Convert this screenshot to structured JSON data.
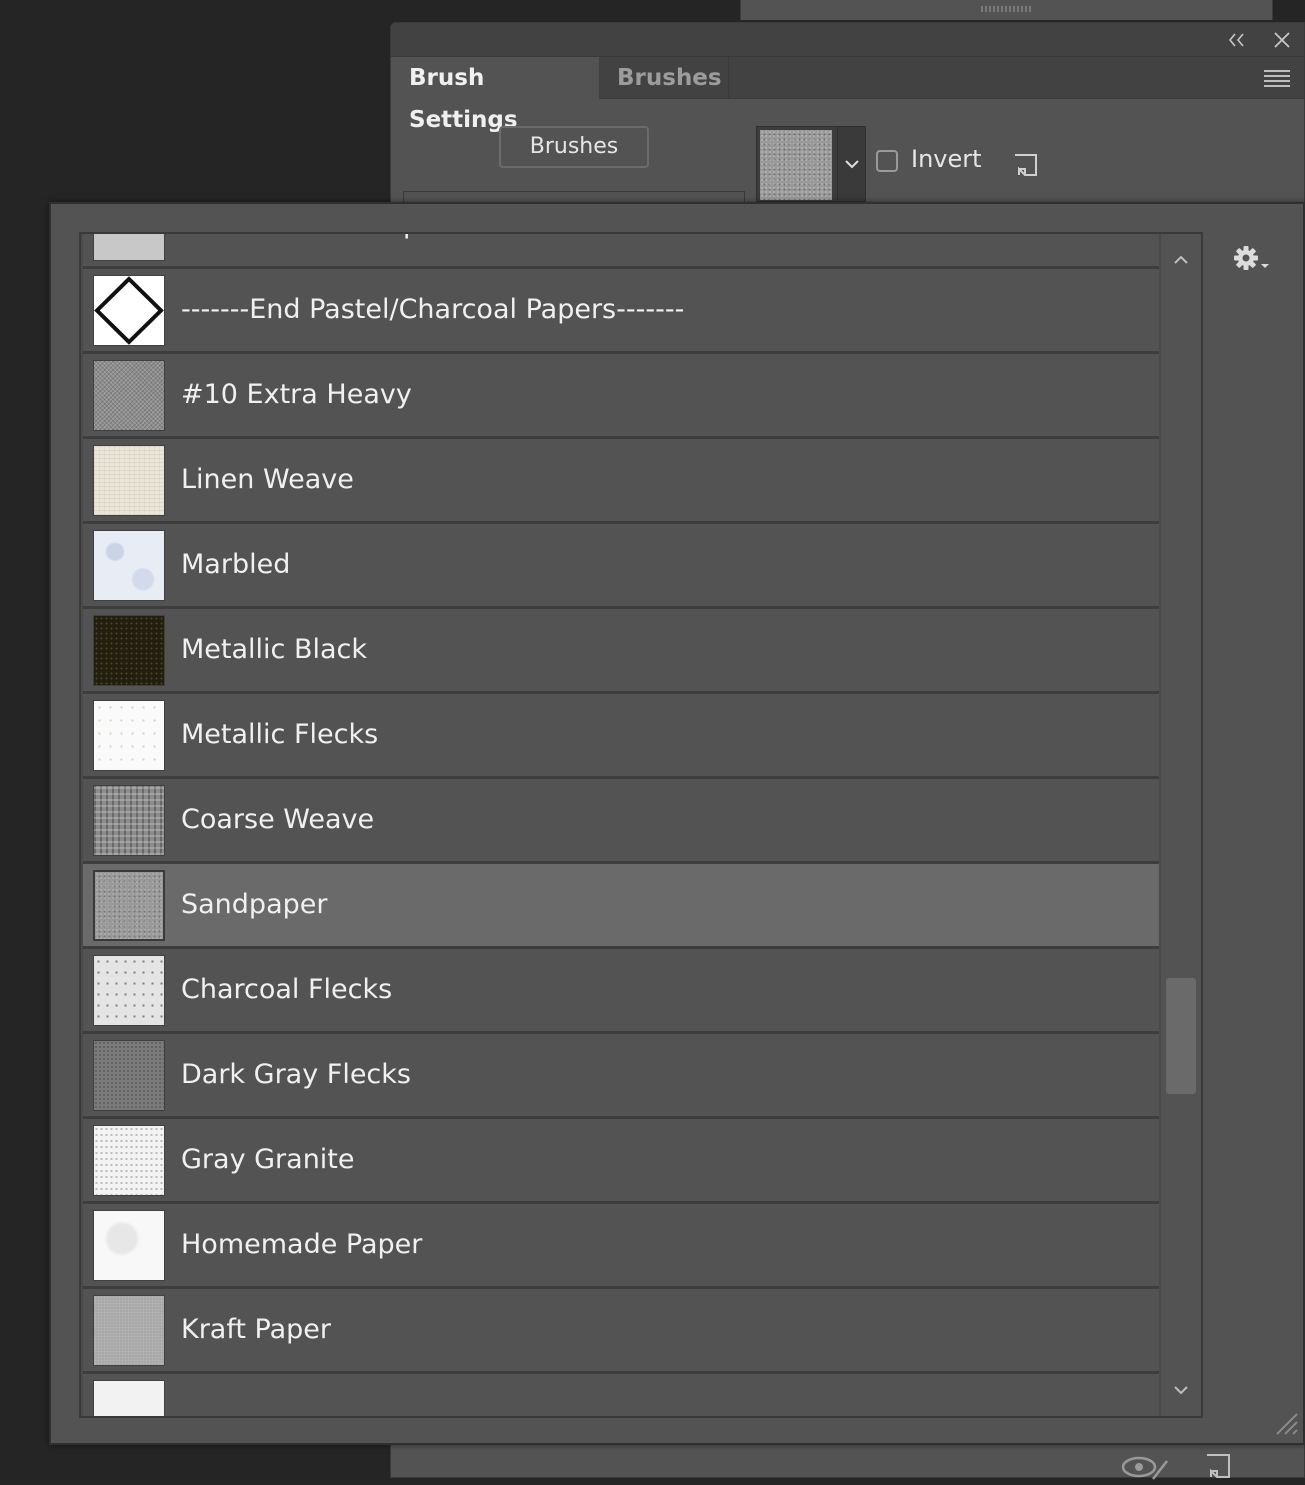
{
  "window": {
    "tabs": [
      {
        "label": "Brush Settings",
        "active": true
      },
      {
        "label": "Brushes",
        "active": false
      }
    ],
    "collapse_icon": "double-chevron-left-icon",
    "close_icon": "close-icon",
    "menu_icon": "panel-menu-icon"
  },
  "brush_settings": {
    "brushes_button_label": "Brushes",
    "texture_dropdown_icon": "chevron-down-icon",
    "invert": {
      "label": "Invert",
      "checked": false
    },
    "new_preset_icon": "new-preset-icon"
  },
  "pattern_picker": {
    "items": [
      {
        "label": "UART Sanded Paper",
        "texture": "uart"
      },
      {
        "label": "-------End Pastel/Charcoal Papers-------",
        "texture": "diamond"
      },
      {
        "label": "#10 Extra Heavy",
        "texture": "extra"
      },
      {
        "label": "Linen Weave",
        "texture": "linen"
      },
      {
        "label": "Marbled",
        "texture": "marbled"
      },
      {
        "label": "Metallic Black",
        "texture": "mblack"
      },
      {
        "label": "Metallic Flecks",
        "texture": "mflecks"
      },
      {
        "label": "Coarse Weave",
        "texture": "coarse"
      },
      {
        "label": "Sandpaper",
        "texture": "sand",
        "selected": true
      },
      {
        "label": "Charcoal Flecks",
        "texture": "charcoal"
      },
      {
        "label": "Dark Gray Flecks",
        "texture": "darkgray"
      },
      {
        "label": "Gray Granite",
        "texture": "granite"
      },
      {
        "label": "Homemade Paper",
        "texture": "homemade"
      },
      {
        "label": "Kraft Paper",
        "texture": "kraft"
      },
      {
        "label": "",
        "texture": "partial"
      }
    ],
    "gear_icon": "gear-icon",
    "scroll_up_icon": "chevron-up-icon",
    "scroll_down_icon": "chevron-down-icon"
  },
  "colors": {
    "panel": "#535353",
    "selected_row": "#6a6a6a",
    "background": "#252525"
  }
}
